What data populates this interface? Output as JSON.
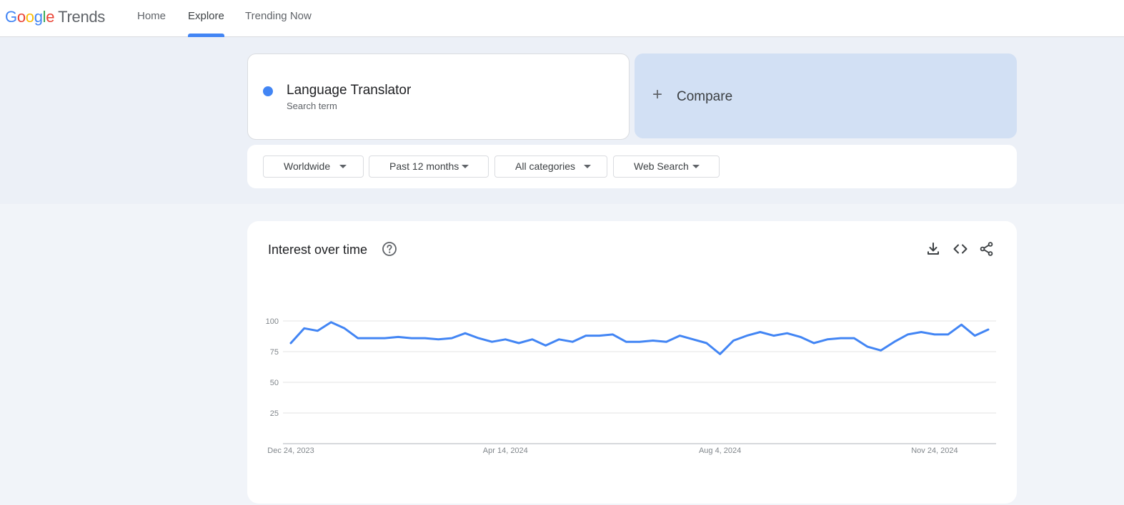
{
  "header": {
    "logo": {
      "g1": "G",
      "o1": "o",
      "o2": "o",
      "g2": "g",
      "l": "l",
      "e": "e",
      "trends": "Trends"
    },
    "nav": [
      {
        "label": "Home",
        "active": false
      },
      {
        "label": "Explore",
        "active": true
      },
      {
        "label": "Trending Now",
        "active": false
      }
    ],
    "accent_color": "#4285f4"
  },
  "search": {
    "term": "Language Translator",
    "term_type": "Search term",
    "term_color": "#4285f4",
    "compare_label": "Compare"
  },
  "filters": {
    "region": "Worldwide",
    "time_range": "Past 12 months",
    "category": "All categories",
    "search_type": "Web Search"
  },
  "chart_panel": {
    "title": "Interest over time",
    "icons": [
      "help-icon",
      "download-icon",
      "embed-code-icon",
      "share-icon"
    ]
  },
  "chart_data": {
    "type": "line",
    "title": "Interest over time",
    "xlabel": "",
    "ylabel": "",
    "ylim": [
      0,
      100
    ],
    "yticks": [
      25,
      50,
      75,
      100
    ],
    "x_tick_labels": [
      "Dec 24, 2023",
      "Apr 14, 2024",
      "Aug 4, 2024",
      "Nov 24, 2024"
    ],
    "grid": true,
    "series": [
      {
        "name": "Language Translator",
        "color": "#4285f4",
        "values": [
          82,
          94,
          92,
          99,
          94,
          86,
          86,
          86,
          87,
          86,
          86,
          85,
          86,
          90,
          86,
          83,
          85,
          82,
          85,
          80,
          85,
          83,
          88,
          88,
          89,
          83,
          83,
          84,
          83,
          88,
          85,
          82,
          73,
          84,
          88,
          91,
          88,
          90,
          87,
          82,
          85,
          86,
          86,
          79,
          76,
          83,
          89,
          91,
          89,
          89,
          97,
          88,
          93
        ]
      }
    ]
  }
}
